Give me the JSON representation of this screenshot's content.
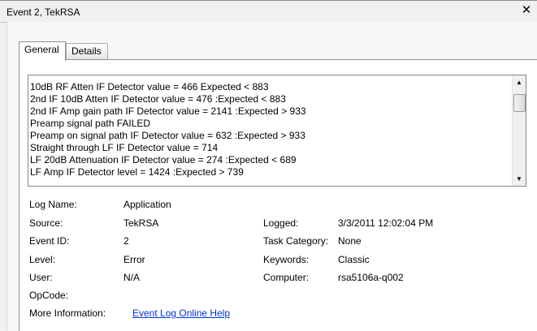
{
  "window": {
    "title": "Event 2, TekRSA",
    "close_glyph": "✕"
  },
  "tabs": [
    {
      "label": "General",
      "active": true
    },
    {
      "label": "Details",
      "active": false
    }
  ],
  "description_lines": [
    "10dB RF Atten IF Detector value = 466  Expected < 883",
    "2nd IF 10dB Atten IF Detector value = 476  :Expected < 883",
    "2nd IF Amp gain path IF Detector value = 2141  :Expected > 933",
    "Preamp signal path FAILED",
    "Preamp on signal path IF Detector value = 632  :Expected > 933",
    "Straight through LF IF Detector value = 714",
    "LF 20dB Attenuation IF Detector value = 274  :Expected < 689",
    "LF Amp IF Detector level = 1424  :Expected > 739"
  ],
  "scrollbar": {
    "up_glyph": "▲",
    "down_glyph": "▼"
  },
  "fields": {
    "log_name": {
      "label": "Log Name:",
      "value": "Application"
    },
    "source": {
      "label": "Source:",
      "value": "TekRSA"
    },
    "logged": {
      "label": "Logged:",
      "value": "3/3/2011 12:02:04 PM"
    },
    "event_id": {
      "label": "Event ID:",
      "value": "2"
    },
    "task_category": {
      "label": "Task Category:",
      "value": "None"
    },
    "level": {
      "label": "Level:",
      "value": "Error"
    },
    "keywords": {
      "label": "Keywords:",
      "value": "Classic"
    },
    "user": {
      "label": "User:",
      "value": "N/A"
    },
    "computer": {
      "label": "Computer:",
      "value": "rsa5106a-q002"
    },
    "opcode": {
      "label": "OpCode:",
      "value": ""
    },
    "more_info": {
      "label": "More Information:",
      "link_text": "Event Log Online Help"
    }
  }
}
